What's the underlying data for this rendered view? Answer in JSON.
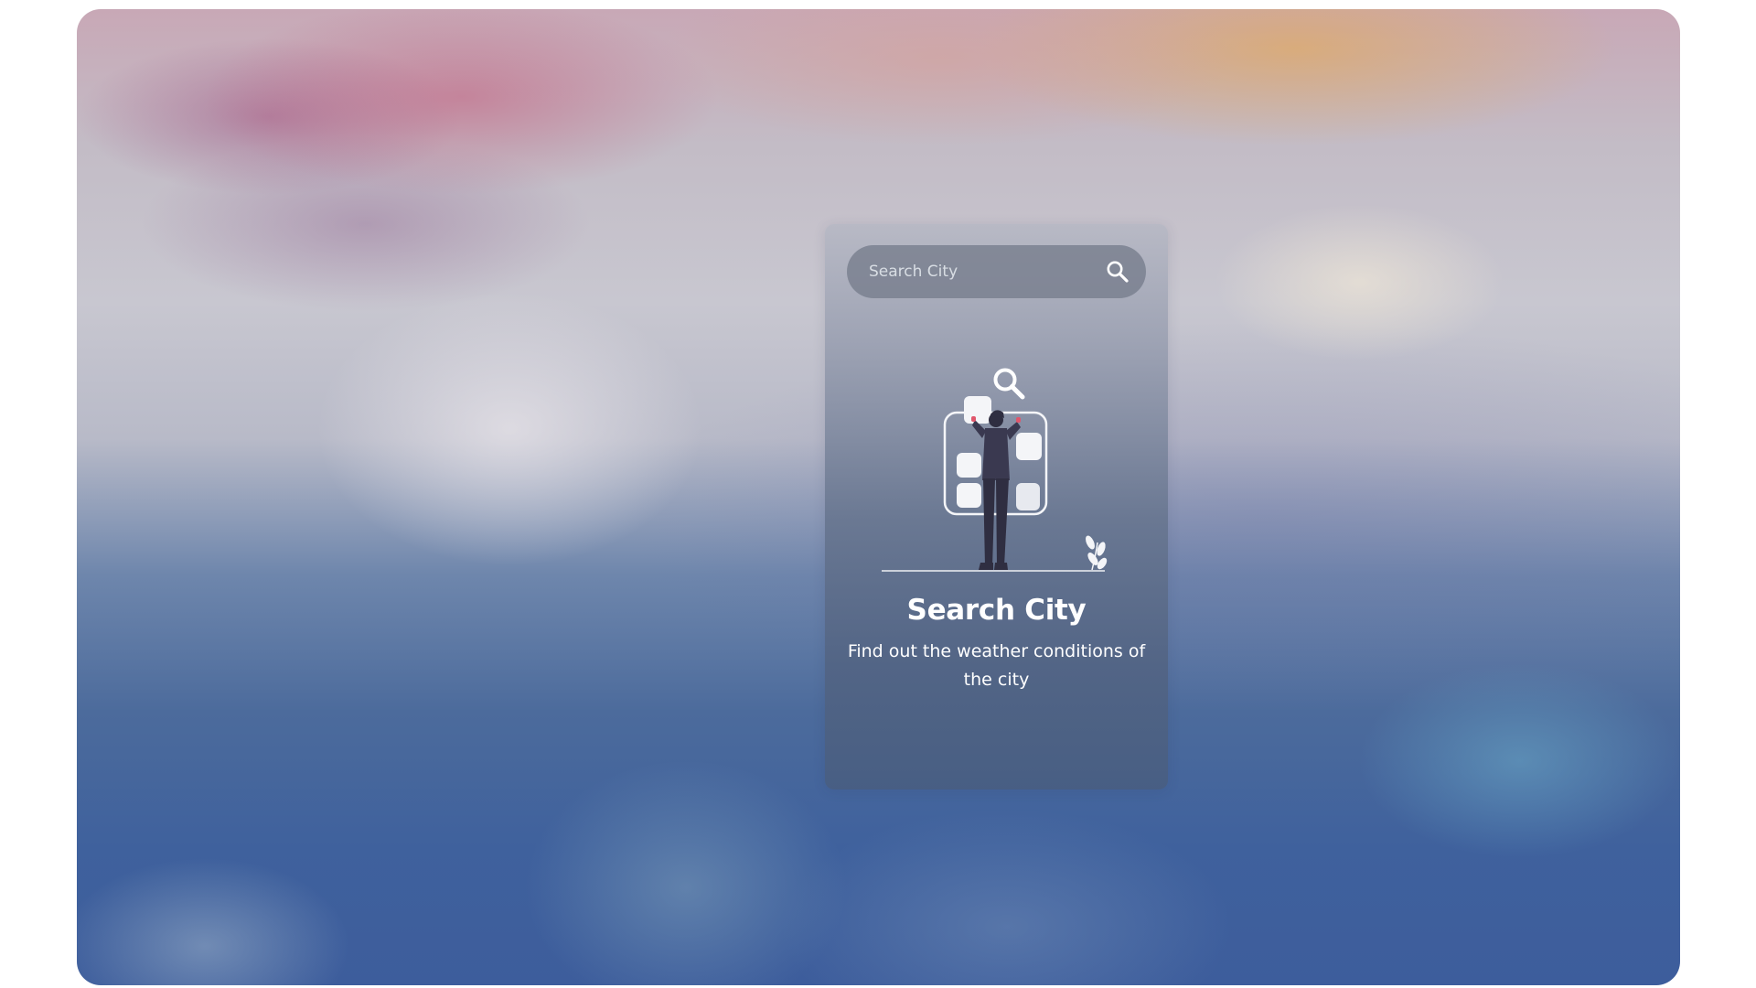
{
  "search": {
    "placeholder": "Search City",
    "value": "",
    "button_icon": "search-icon"
  },
  "empty_state": {
    "illustration": "person-searching-icon",
    "title": "Search City",
    "subtitle": "Find out the weather conditions of the city"
  },
  "colors": {
    "card_text": "#ffffff",
    "search_bar_bg": "#767c8c",
    "illustration_figure": "#2f2e41",
    "illustration_accent": "#e0566c"
  }
}
